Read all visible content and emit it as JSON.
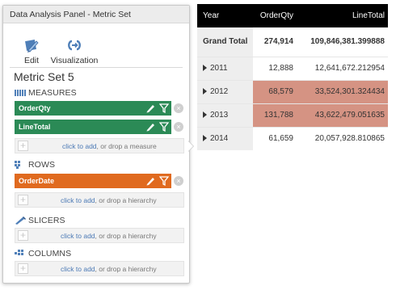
{
  "panel": {
    "title": "Data Analysis Panel - Metric Set",
    "toolbar": {
      "edit_label": "Edit",
      "visualization_label": "Visualization"
    },
    "metric_set_title": "Metric Set 5",
    "sections": {
      "measures": "MEASURES",
      "rows": "ROWS",
      "slicers": "SLICERS",
      "columns": "COLUMNS"
    },
    "fields": {
      "measure_1": "OrderQty",
      "measure_2": "LineTotal",
      "row_1": "OrderDate"
    },
    "drop": {
      "click_to_add": "click to add",
      "measure_suffix": ", or drop a measure",
      "hierarchy_suffix": ", or drop a hierarchy",
      "plus": "+"
    },
    "remove_symbol": "×"
  },
  "grid": {
    "headers": [
      "Year",
      "OrderQty",
      "LineTotal"
    ],
    "total": {
      "label": "Grand Total",
      "qty": "274,914",
      "line": "109,846,381.399888"
    },
    "rows": [
      {
        "year": "2011",
        "qty": "12,888",
        "line": "12,641,672.212954",
        "highlight": false
      },
      {
        "year": "2012",
        "qty": "68,579",
        "line": "33,524,301.324434",
        "highlight": true
      },
      {
        "year": "2013",
        "qty": "131,788",
        "line": "43,622,479.051635",
        "highlight": true
      },
      {
        "year": "2014",
        "qty": "61,659",
        "line": "20,057,928.810865",
        "highlight": false
      }
    ]
  },
  "colors": {
    "measure_field": "#2b8a56",
    "row_field": "#e06a1f",
    "highlight_cell": "#d59383",
    "header_bg": "#000000",
    "link": "#4b79b5"
  },
  "icons": {
    "edit": "pencil-ruler-icon",
    "visualization": "visualization-icon",
    "measures": "measures-icon",
    "rows": "rows-icon",
    "slicers": "slicers-icon",
    "columns": "columns-icon",
    "field_edit": "pencil-icon",
    "field_filter": "filter-icon",
    "remove": "remove-icon",
    "expand": "expand-triangle-icon"
  }
}
